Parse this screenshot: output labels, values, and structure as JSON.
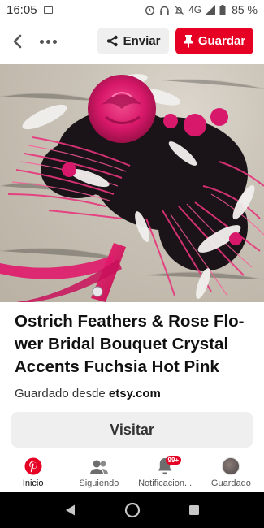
{
  "status_bar": {
    "time": "16:05",
    "network": "4G",
    "battery_text": "85 %"
  },
  "header": {
    "share_label": "Enviar",
    "save_label": "Guardar"
  },
  "pin": {
    "title": "Ostrich Feathers & Rose Flo-wer Bridal Bouquet Crystal Accents Fuchsia Hot Pink",
    "title_lines": [
      "Ostrich Feathers & Rose Flo-",
      "wer Bridal Bouquet Crystal",
      "Accents Fuchsia Hot Pink"
    ],
    "saved_from_prefix": "Guardado desde ",
    "saved_from_source": "etsy.com",
    "visit_label": "Visitar"
  },
  "bottom_nav": {
    "items": [
      {
        "label": "Inicio",
        "icon": "pinterest-icon",
        "active": true
      },
      {
        "label": "Siguiendo",
        "icon": "following-icon",
        "active": false
      },
      {
        "label": "Notificacion...",
        "icon": "bell-icon",
        "active": false,
        "badge": "99+"
      },
      {
        "label": "Guardado",
        "icon": "avatar",
        "active": false
      }
    ]
  },
  "colors": {
    "brand_red": "#e60023",
    "fuchsia": "#e0186c",
    "button_grey": "#efefef"
  }
}
